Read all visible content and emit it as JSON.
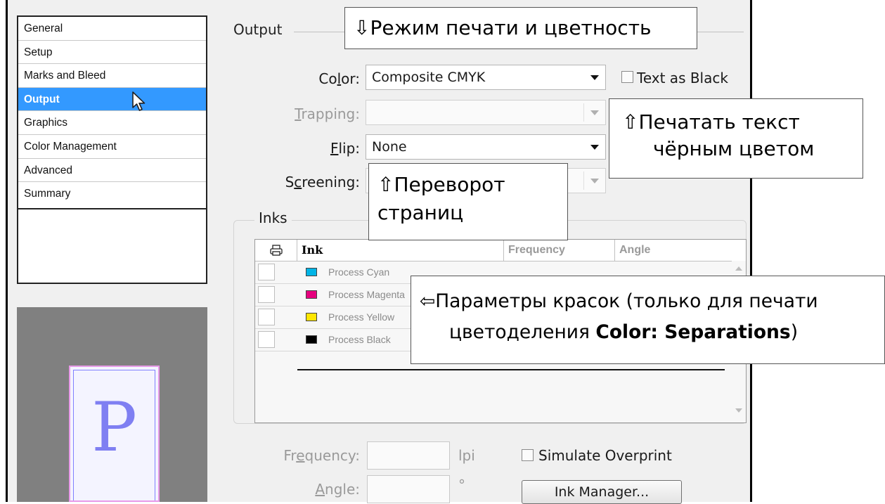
{
  "sidebar": {
    "items": [
      {
        "label": "General"
      },
      {
        "label": "Setup"
      },
      {
        "label": "Marks and Bleed"
      },
      {
        "label": "Output"
      },
      {
        "label": "Graphics"
      },
      {
        "label": "Color Management"
      },
      {
        "label": "Advanced"
      },
      {
        "label": "Summary"
      }
    ],
    "selected": "Output"
  },
  "preview": {
    "letter": "P"
  },
  "output": {
    "title": "Output",
    "color": {
      "label_pre": "Co",
      "label_u": "l",
      "label_post": "or:",
      "value": "Composite CMYK"
    },
    "text_as_black": {
      "label": "Text as Black",
      "checked": false
    },
    "trapping": {
      "label_u": "T",
      "label_post": "rapping:",
      "value": ""
    },
    "flip": {
      "label_u": "F",
      "label_post": "lip:",
      "value": "None"
    },
    "screening": {
      "label_pre": "S",
      "label_u": "c",
      "label_post": "reening:",
      "value": ""
    }
  },
  "inks": {
    "legend": "Inks",
    "columns": {
      "ink": "Ink",
      "frequency": "Frequency",
      "angle": "Angle"
    },
    "rows": [
      {
        "name": "Process Cyan",
        "color": "#00b4e6"
      },
      {
        "name": "Process Magenta",
        "color": "#e6007e"
      },
      {
        "name": "Process Yellow",
        "color": "#ffe600"
      },
      {
        "name": "Process Black",
        "color": "#000000"
      }
    ]
  },
  "bottom": {
    "frequency": {
      "label_pre": "Fr",
      "label_u": "e",
      "label_post": "quency:",
      "unit": "lpi"
    },
    "angle": {
      "label_u": "A",
      "label_post": "ngle:",
      "unit": "°"
    },
    "simulate_overprint": {
      "label": "Simulate Overprint",
      "checked": false
    },
    "ink_manager_button": "Ink Manager..."
  },
  "callouts": {
    "mode": "⇩Режим печати и цветность",
    "text_black_line1": "⇧Печатать текст",
    "text_black_line2": "чёрным цветом",
    "flip_line1": "⇧Переворот",
    "flip_line2": "страниц",
    "inks_line1": "⇦Параметры красок (только для печати",
    "inks_line2_pre": "цветоделения ",
    "inks_line2_bold": "Color: Separations",
    "inks_line2_post": ")"
  }
}
